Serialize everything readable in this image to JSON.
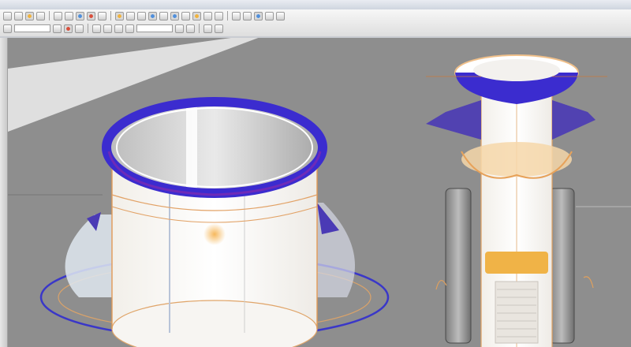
{
  "window": {
    "title": ""
  },
  "toolbar": {
    "row1": [
      "new-icon",
      "open-icon",
      "save-icon",
      "print-icon",
      "undo-icon",
      "redo-icon",
      "select-icon",
      "rebuild-icon",
      "options-icon",
      "sketch-icon",
      "extrude-icon",
      "revolve-icon",
      "sweep-icon",
      "loft-icon",
      "fillet-icon",
      "chamfer-icon",
      "shell-icon",
      "rib-icon",
      "draft-icon",
      "mirror-icon",
      "pattern-icon",
      "plane-icon",
      "axis-icon",
      "point-icon"
    ],
    "row2": [
      "zoom-fit-icon",
      "zoom-area-icon",
      "rotate-icon",
      "pan-icon",
      "section-icon",
      "view-orientation-icon",
      "display-style-icon",
      "hide-show-icon",
      "appearance-icon",
      "scene-icon",
      "measure-icon",
      "mass-properties-icon"
    ]
  },
  "colors": {
    "accent_blue": "#3b2ccf",
    "accent_orange": "#e28a2b",
    "viewport_bg": "#8e8e8e",
    "model_body": "#f7f5f2"
  }
}
